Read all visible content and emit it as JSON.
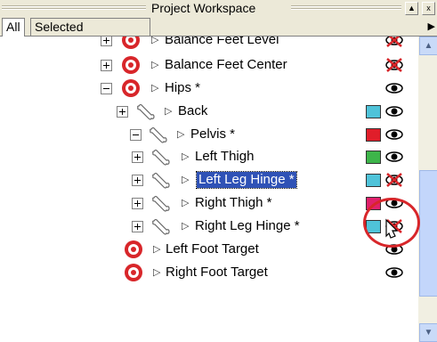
{
  "window": {
    "title": "Project Workspace",
    "min_glyph": "▲",
    "close_glyph": "x"
  },
  "tabs": [
    {
      "label": "All",
      "active": true
    },
    {
      "label": "Selected",
      "active": false
    }
  ],
  "tab_scroll_glyph": "▶",
  "tree": [
    {
      "label": "Balance Feet Level",
      "type": "target",
      "expander": "plus",
      "visibility": "hidden",
      "swatch": null
    },
    {
      "label": "Balance Feet Center",
      "type": "target",
      "expander": "plus",
      "visibility": "hidden",
      "swatch": null
    },
    {
      "label": "Hips *",
      "type": "target",
      "expander": "minus",
      "visibility": "visible",
      "swatch": null
    },
    {
      "label": "Back",
      "type": "bone",
      "expander": "plus",
      "visibility": "visible",
      "swatch": "#4fc3d9"
    },
    {
      "label": "Pelvis *",
      "type": "bone",
      "expander": "minus",
      "visibility": "visible",
      "swatch": "#e01e2a"
    },
    {
      "label": "Left Thigh",
      "type": "bone",
      "expander": "plus",
      "visibility": "visible",
      "swatch": "#3db54a"
    },
    {
      "label": "Left Leg Hinge *",
      "type": "bone",
      "expander": "plus",
      "visibility": "hidden",
      "swatch": "#4fc3d9",
      "selected": true
    },
    {
      "label": "Right Thigh *",
      "type": "bone",
      "expander": "plus",
      "visibility": "visible",
      "swatch": "#e0206b"
    },
    {
      "label": "Right Leg Hinge *",
      "type": "bone",
      "expander": "plus",
      "visibility": "hidden",
      "swatch": "#4fc3d9"
    },
    {
      "label": "Left Foot Target",
      "type": "target",
      "expander": null,
      "visibility": "visible",
      "swatch": null
    },
    {
      "label": "Right Foot Target",
      "type": "target",
      "expander": null,
      "visibility": "visible",
      "swatch": null
    }
  ],
  "colors": {
    "selection": "#2f52b6",
    "target_red": "#d8262a",
    "highlight_circle": "#d8262a"
  }
}
